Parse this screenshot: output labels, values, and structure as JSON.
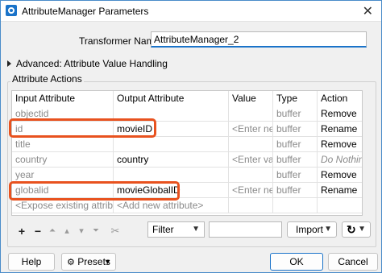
{
  "window": {
    "title": "AttributeManager Parameters",
    "close": "✕"
  },
  "transformer": {
    "label": "Transformer Name:",
    "value": "AttributeManager_2"
  },
  "advanced": {
    "label": "Advanced: Attribute Value Handling"
  },
  "actions": {
    "group_label": "Attribute Actions",
    "columns": [
      "Input Attribute",
      "Output Attribute",
      "Value",
      "Type",
      "Action"
    ],
    "rows": [
      [
        "objectid",
        "",
        "",
        "buffer",
        "Remove"
      ],
      [
        "id",
        "movieID",
        "<Enter new v",
        "buffer",
        "Rename"
      ],
      [
        "title",
        "",
        "",
        "buffer",
        "Remove"
      ],
      [
        "country",
        "country",
        "<Enter value",
        "buffer",
        "Do Nothing"
      ],
      [
        "year",
        "",
        "",
        "buffer",
        "Remove"
      ],
      [
        "globalid",
        "movieGlobalID",
        "<Enter new v",
        "buffer",
        "Rename"
      ],
      [
        "<Expose existing attribute>",
        "<Add new attribute>",
        "",
        "",
        ""
      ]
    ]
  },
  "toolbar": {
    "add": "+",
    "remove": "−",
    "move_top": "⏶",
    "move_up": "▴",
    "move_down": "▾",
    "move_bottom": "⏷",
    "cut": "✂",
    "filter_label": "Filter",
    "filter_value": "",
    "import_label": "Import",
    "refresh": "↻"
  },
  "footer": {
    "help": "Help",
    "presets": "Presets",
    "ok": "OK",
    "cancel": "Cancel"
  },
  "colors": {
    "highlight": "#e8521f",
    "accent": "#1a73c9"
  }
}
